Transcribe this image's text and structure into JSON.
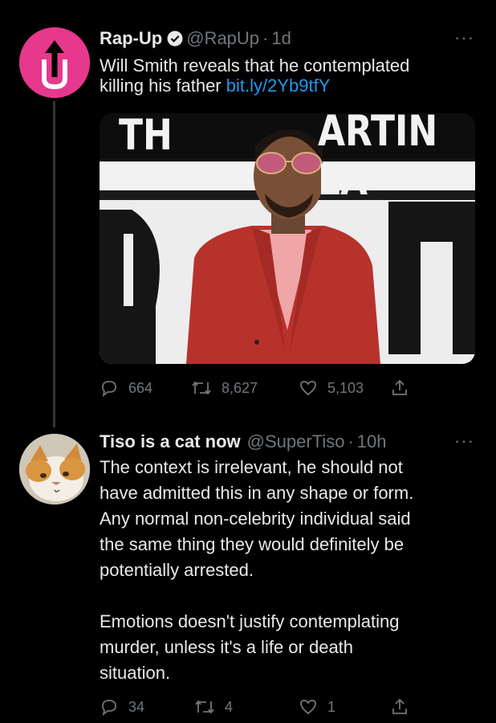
{
  "tweet1": {
    "display_name": "Rap-Up",
    "handle": "@RapUp",
    "separator": "·",
    "time": "1d",
    "text_line1": "Will Smith reveals that he contemplated",
    "text_line2": "killing his father",
    "link": "bit.ly/2Yb9tfY",
    "media_sign_left": "TH",
    "media_sign_right": "ARTIN LA",
    "replies": "664",
    "retweets": "8,627",
    "likes": "5,103"
  },
  "tweet2": {
    "display_name": "Tiso is a cat now",
    "handle": "@SuperTiso",
    "separator": "·",
    "time": "10h",
    "lines": [
      "The context is irrelevant, he should not",
      "have admitted this in any shape or form.",
      "Any normal non-celebrity individual said",
      "the same thing they would definitely be",
      "potentially arrested.",
      "Emotions doesn't justify contemplating",
      "murder, unless it's a life or death",
      "situation."
    ],
    "replies": "34",
    "retweets": "4",
    "likes": "1"
  },
  "icons": {
    "verified": "verified-badge-icon",
    "reply": "reply-icon",
    "retweet": "retweet-icon",
    "like": "like-icon",
    "share": "share-icon",
    "more": "more-icon"
  },
  "colors": {
    "background": "#000000",
    "text": "#e7e9ea",
    "muted": "#71767b",
    "link": "#1d9bf0",
    "brand": "#e83e8c"
  }
}
